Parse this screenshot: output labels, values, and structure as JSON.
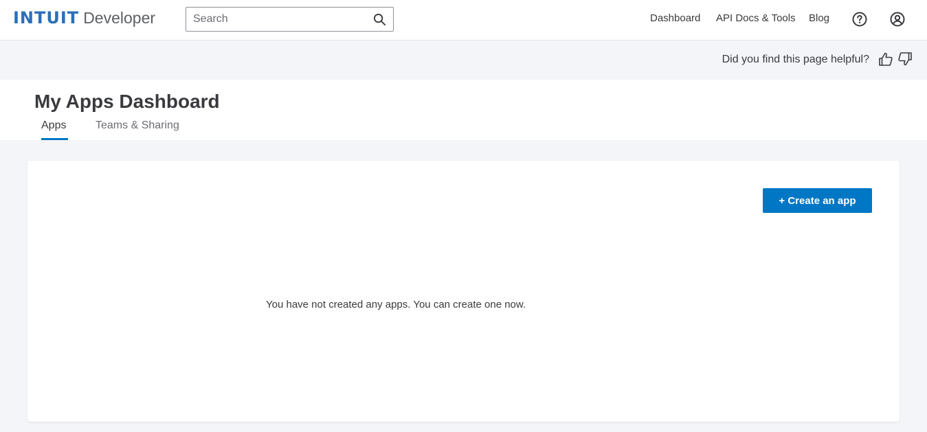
{
  "header": {
    "logo_mark": "INTUIT",
    "logo_word": "Developer",
    "search_placeholder": "Search",
    "nav": [
      "Dashboard",
      "API Docs & Tools",
      "Blog"
    ],
    "icons": [
      "search-icon",
      "help-icon",
      "account-icon"
    ]
  },
  "feedback": {
    "question": "Did you find this page helpful?",
    "icons": [
      "thumbs-up-icon",
      "thumbs-down-icon"
    ]
  },
  "page": {
    "title": "My Apps Dashboard",
    "tabs": [
      {
        "label": "Apps",
        "active": true
      },
      {
        "label": "Teams & Sharing",
        "active": false
      }
    ]
  },
  "card": {
    "create_button": "+ Create an app",
    "empty_message": "You have not created any apps. You can create one now."
  },
  "colors": {
    "brand_blue": "#0077c5",
    "logo_blue": "#2b6fba",
    "page_bg": "#f4f5f8",
    "text": "#393a3d"
  }
}
